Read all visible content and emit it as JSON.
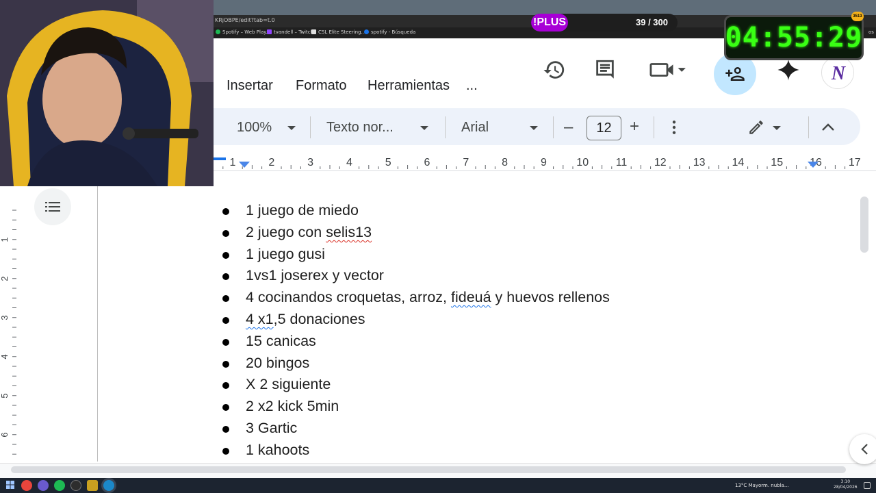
{
  "browser": {
    "url_fragment": "KRjOBPE/edit?tab=t.0",
    "bookmarks": [
      "Spotify – Web Play...",
      "tvandell – Twitch",
      "CSL Elite Steering...",
      "spotify - Búsqueda"
    ],
    "bookmark_colors": [
      "#1db954",
      "#9146ff",
      "#e0e0e0",
      "#1a73e8"
    ],
    "bookmark_overflow": "os"
  },
  "menu": {
    "items": [
      "Insertar",
      "Formato",
      "Herramientas",
      "..."
    ]
  },
  "toolbar": {
    "zoom": "100%",
    "style": "Texto nor...",
    "font": "Arial",
    "font_size": "12",
    "decrease_label": "–",
    "increase_label": "+"
  },
  "ruler": {
    "numbers": [
      "1",
      "2",
      "3",
      "4",
      "5",
      "6",
      "7",
      "8",
      "9",
      "10",
      "11",
      "12",
      "13",
      "14",
      "15",
      "16",
      "17"
    ]
  },
  "vruler": {
    "numbers": [
      "1",
      "2",
      "3",
      "4",
      "5",
      "6"
    ]
  },
  "document": {
    "items": [
      {
        "pre": "1 juego de miedo",
        "flag": "",
        "post": ""
      },
      {
        "pre": "2 juego con ",
        "flag": "selis13",
        "post": "",
        "flag_type": "red"
      },
      {
        "pre": "1 juego gusi",
        "flag": "",
        "post": ""
      },
      {
        "pre": "1vs1 joserex y vector",
        "flag": "",
        "post": ""
      },
      {
        "pre": "4 cocinandos croquetas, arroz,  ",
        "flag": "fideuá",
        "post": " y huevos rellenos",
        "flag_type": "blue"
      },
      {
        "pre": "",
        "flag": "4 x1",
        "post": ",5 donaciones",
        "flag_type": "blue"
      },
      {
        "pre": "15 canicas",
        "flag": "",
        "post": ""
      },
      {
        "pre": "20 bingos",
        "flag": "",
        "post": ""
      },
      {
        "pre": "X 2 siguiente",
        "flag": "",
        "post": ""
      },
      {
        "pre": "2 x2 kick 5min",
        "flag": "",
        "post": ""
      },
      {
        "pre": "3 Gartic",
        "flag": "",
        "post": ""
      },
      {
        "pre": "1 kahoots",
        "flag": "",
        "post": ""
      }
    ]
  },
  "overlay": {
    "plus_label": "!PLUS",
    "plus_count": "39 / 300",
    "timer": "04:55:29",
    "coins": "3513",
    "avatar_letter": "N"
  },
  "taskbar": {
    "weather": "13°C  Mayorm. nubla...",
    "time": "3:10",
    "date": "28/04/2026"
  },
  "colors": {
    "accent": "#c2e7ff",
    "toolbar_bg": "#edf2fa",
    "timer_green": "#39ff14",
    "plus_purple": "#a700d6"
  }
}
